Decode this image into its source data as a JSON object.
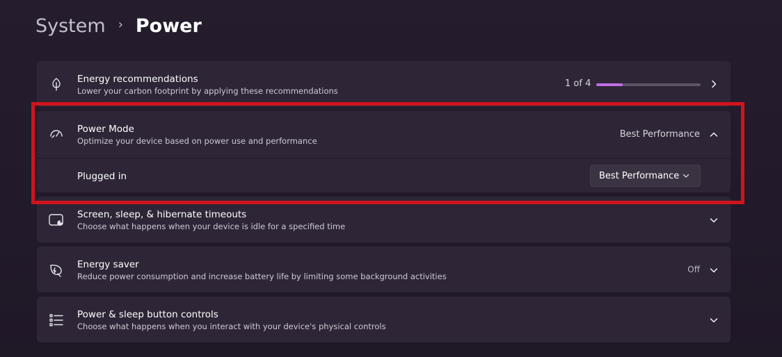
{
  "breadcrumb": {
    "parent": "System",
    "separator": "›",
    "current": "Power"
  },
  "energy_recommendations": {
    "title": "Energy recommendations",
    "description": "Lower your carbon footprint by applying these recommendations",
    "progress_text": "1 of 4",
    "progress_fraction": 0.25,
    "icon": "leaf-icon"
  },
  "power_mode": {
    "title": "Power Mode",
    "description": "Optimize your device based on power use and performance",
    "value": "Best Performance",
    "icon": "gauge-icon",
    "plugged_in": {
      "label": "Plugged in",
      "selected": "Best Performance"
    }
  },
  "screen_sleep": {
    "title": "Screen, sleep, & hibernate timeouts",
    "description": "Choose what happens when your device is idle for a specified time",
    "icon": "screen-sleep-icon"
  },
  "energy_saver": {
    "title": "Energy saver",
    "description": "Reduce power consumption and increase battery life by limiting some background activities",
    "value": "Off",
    "icon": "energy-saver-icon"
  },
  "power_buttons": {
    "title": "Power & sleep button controls",
    "description": "Choose what happens when you interact with your device's physical controls",
    "icon": "list-icon"
  },
  "colors": {
    "accent": "#c06ee0",
    "highlight": "#d0141c",
    "card": "#2e2636",
    "background": "#251d2d"
  }
}
